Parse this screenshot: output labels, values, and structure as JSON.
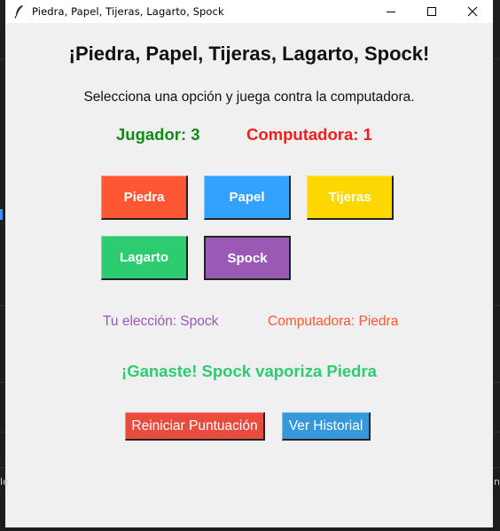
{
  "window": {
    "title": "Piedra, Papel, Tijeras, Lagarto, Spock",
    "icon": "feather-icon"
  },
  "game": {
    "heading": "¡Piedra, Papel, Tijeras, Lagarto, Spock!",
    "instructions": "Selecciona una opción y juega contra la computadora.",
    "player_score": "Jugador: 3",
    "computer_score": "Computadora: 1",
    "choices": [
      {
        "label": "Piedra",
        "color": "#ff5733"
      },
      {
        "label": "Papel",
        "color": "#33a1ff"
      },
      {
        "label": "Tijeras",
        "color": "#ffd700"
      },
      {
        "label": "Lagarto",
        "color": "#2ecc71"
      },
      {
        "label": "Spock",
        "color": "#9b59b6",
        "selected": true
      }
    ],
    "player_choice": "Tu elección: Spock",
    "computer_choice": "Computadora: Piedra",
    "result": "¡Ganaste! Spock vaporiza Piedra",
    "reset_label": "Reiniciar Puntuación",
    "history_label": "Ver Historial"
  },
  "colors": {
    "player": "#148a14",
    "computer": "#f21d1d",
    "player_choice": "#9b59b6",
    "computer_choice": "#ff5733",
    "result": "#2ecc71",
    "reset_button": "#e74c3c",
    "history_button": "#3498db"
  }
}
